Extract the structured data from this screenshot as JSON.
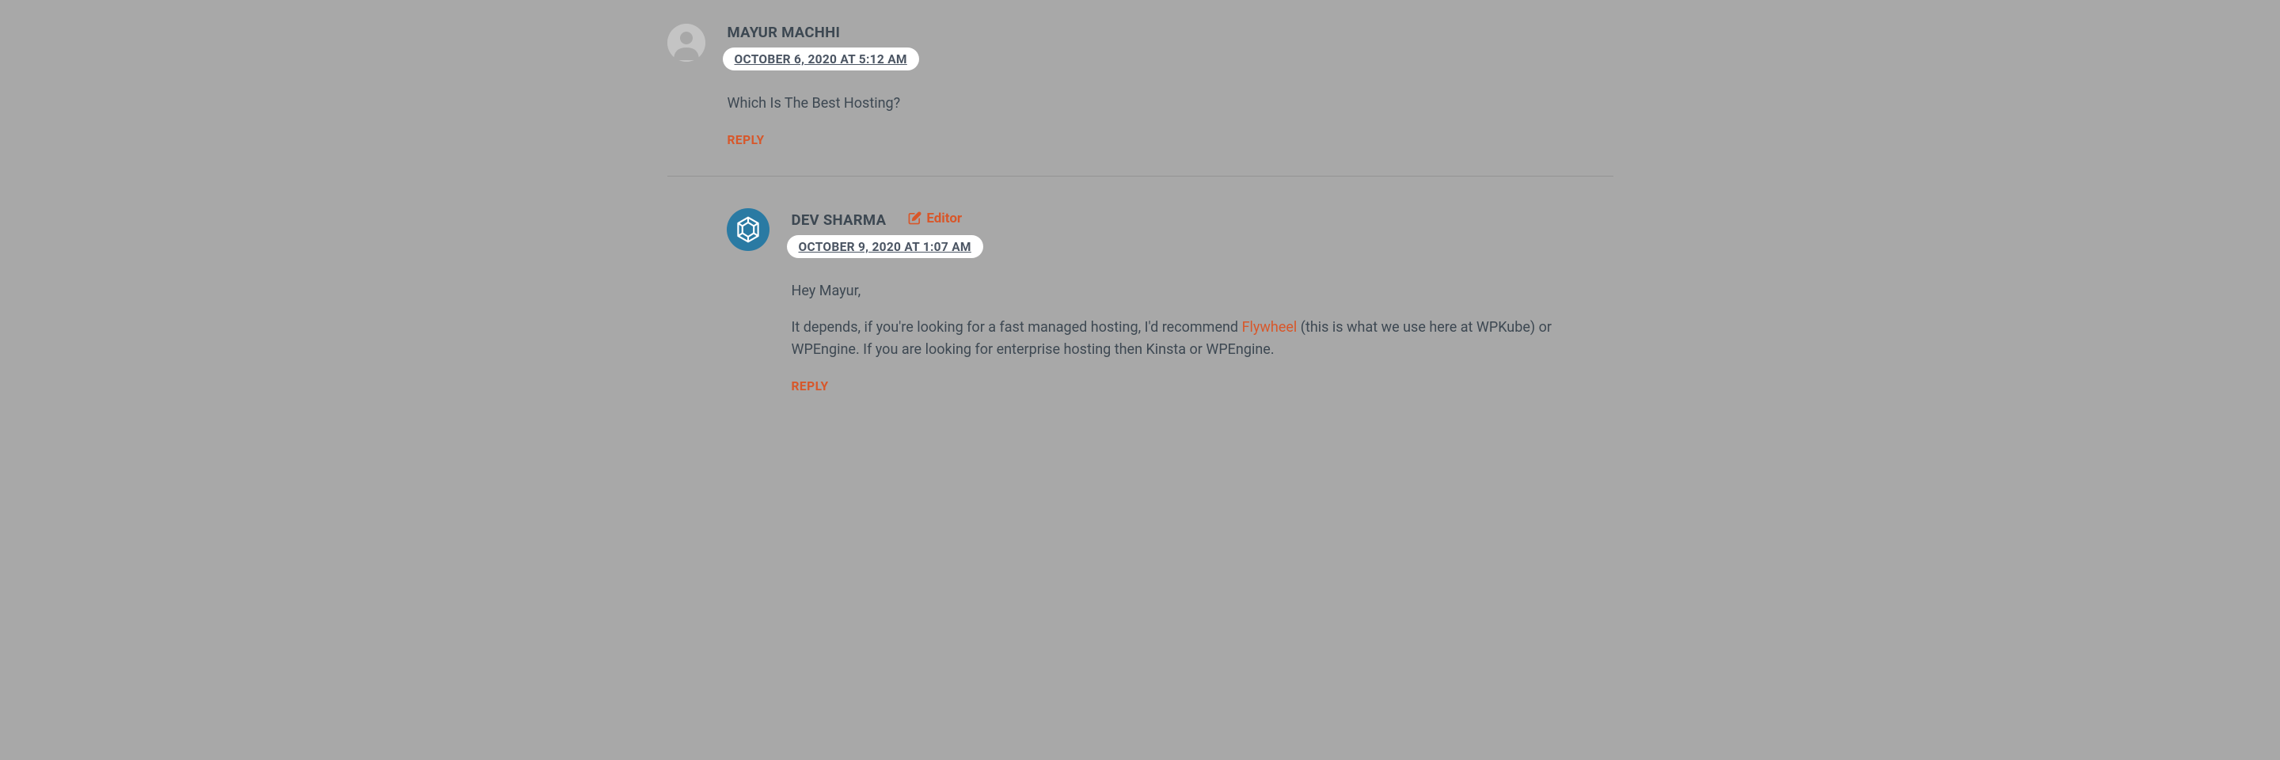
{
  "comments": [
    {
      "author": "MAYUR MACHHI",
      "timestamp": "OCTOBER 6, 2020 AT 5:12 AM",
      "editor": false,
      "body": "Which Is The Best Hosting?",
      "reply_label": "REPLY",
      "level": 0
    },
    {
      "author": "DEV SHARMA",
      "timestamp": "OCTOBER 9, 2020 AT 1:07 AM",
      "editor": true,
      "editor_label": "Editor",
      "greeting": "Hey Mayur,",
      "body_pre": "It depends, if you're looking for a fast managed hosting, I'd recommend ",
      "body_link": "Flywheel",
      "body_post": " (this is what we use here at WPKube) or WPEngine. If you are looking for enterprise hosting then Kinsta or WPEngine.",
      "reply_label": "REPLY",
      "level": 1
    }
  ]
}
